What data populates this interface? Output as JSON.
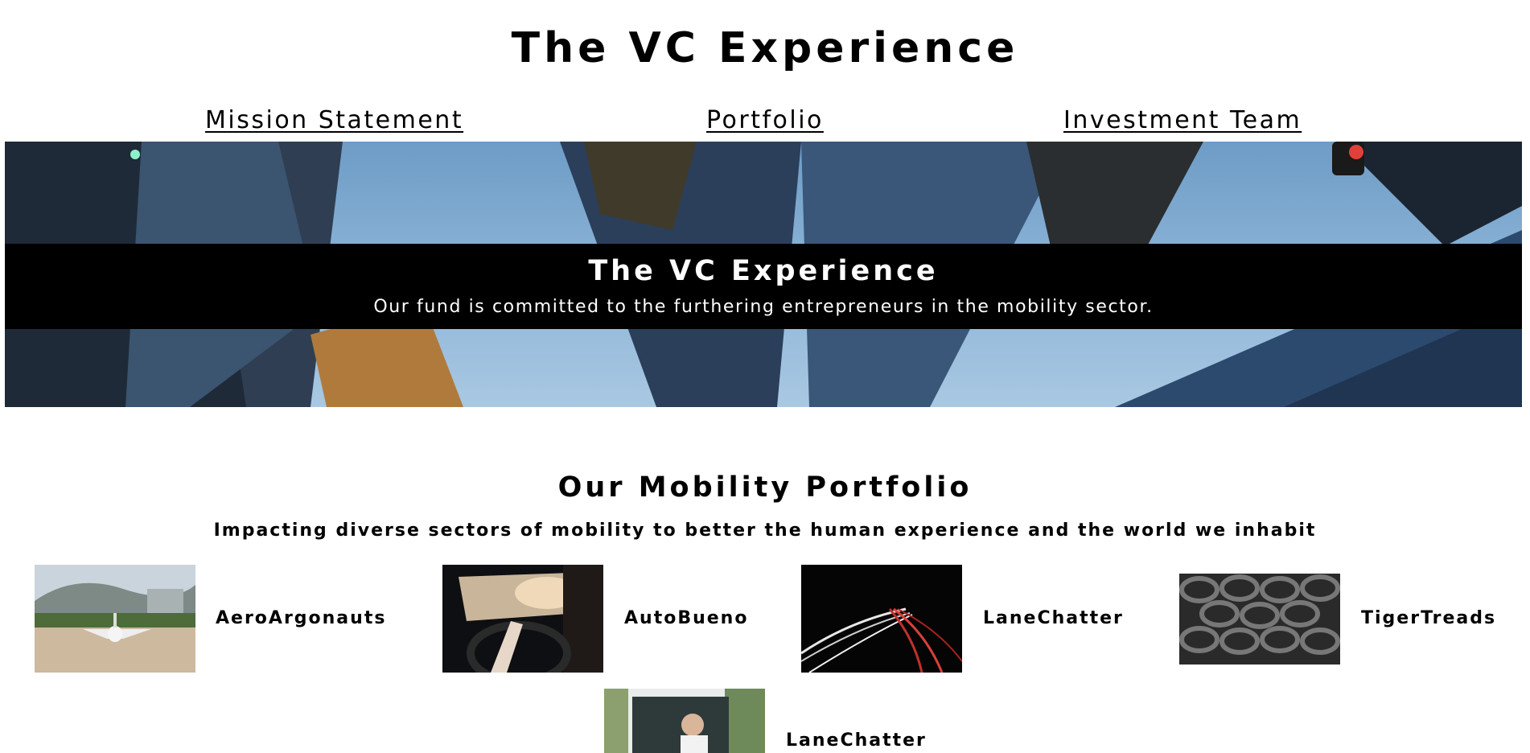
{
  "site": {
    "title": "The VC Experience"
  },
  "nav": {
    "mission": "Mission Statement",
    "portfolio": "Portfolio",
    "team": "Investment Team"
  },
  "hero": {
    "title": "The VC Experience",
    "subtitle": "Our fund is committed to the furthering entrepreneurs in the mobility sector."
  },
  "portfolio": {
    "heading": "Our Mobility Portfolio",
    "subheading": "Impacting diverse sectors of mobility to better the human experience and the world we inhabit",
    "companies": [
      {
        "name": "AeroArgonauts",
        "image": "private-jet-on-runway"
      },
      {
        "name": "AutoBueno",
        "image": "driver-hands-on-steering-wheel"
      },
      {
        "name": "LaneChatter",
        "image": "highway-light-trails-at-night"
      },
      {
        "name": "TigerTreads",
        "image": "stacked-tires"
      },
      {
        "name": "LaneChatter",
        "image": "smiling-man-in-car-window"
      }
    ]
  }
}
